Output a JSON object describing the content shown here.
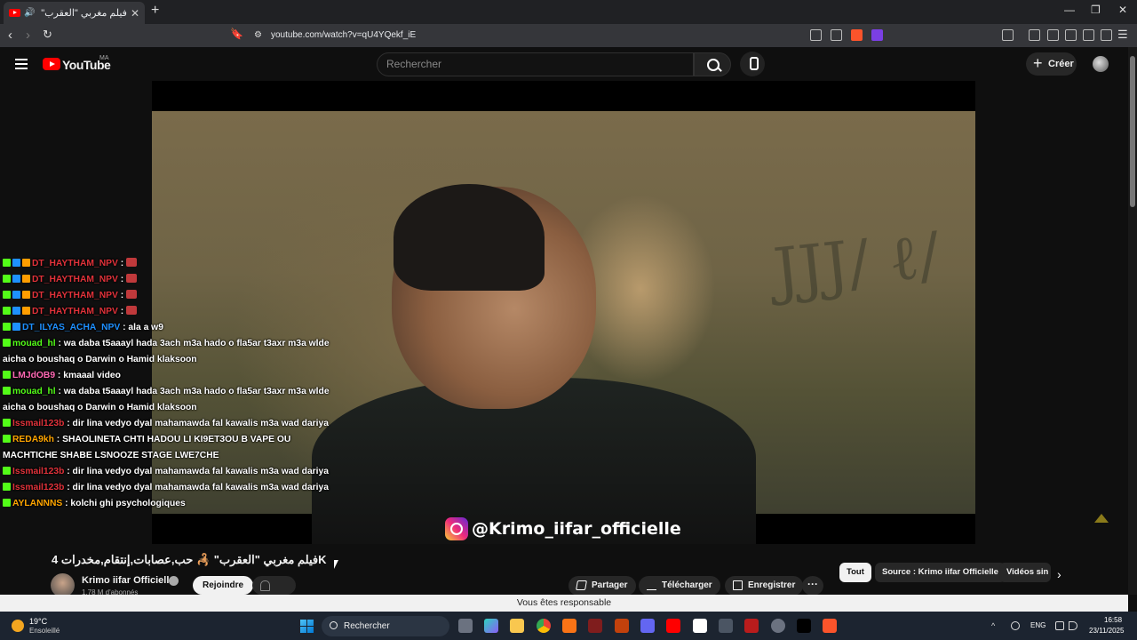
{
  "browser": {
    "tab_title": "فيلم مغربي \"العقرب\" 🦂 حب...",
    "new_tab": "+",
    "url": "youtube.com/watch?v=qU4YQekf_iE",
    "window_min": "—",
    "window_max": "❐",
    "window_close": "✕",
    "tab_close": "✕"
  },
  "youtube": {
    "logo_text": "YouTube",
    "country_code": "MA",
    "search_placeholder": "Rechercher",
    "create_label": "Créer"
  },
  "video": {
    "watermark": "@Krimo_iifar_officielle",
    "graffiti": "JJJ/ ℓ/"
  },
  "chat": [
    {
      "badges": [
        "k",
        "v",
        "o"
      ],
      "user": "DT_HAYTHAM_NPV",
      "user_color": "#e0323a",
      "text": "",
      "emote": true
    },
    {
      "badges": [
        "k",
        "v",
        "o"
      ],
      "user": "DT_HAYTHAM_NPV",
      "user_color": "#e0323a",
      "text": "",
      "emote": true
    },
    {
      "badges": [
        "k",
        "v",
        "o"
      ],
      "user": "DT_HAYTHAM_NPV",
      "user_color": "#e0323a",
      "text": "",
      "emote": true
    },
    {
      "badges": [
        "k",
        "v",
        "o"
      ],
      "user": "DT_HAYTHAM_NPV",
      "user_color": "#e0323a",
      "text": "",
      "emote": true
    },
    {
      "badges": [
        "k",
        "v"
      ],
      "user": "DT_ILYAS_ACHA_NPV",
      "user_color": "#1e90ff",
      "text": "ala a w9",
      "emote": false
    },
    {
      "badges": [
        "k"
      ],
      "user": "mouad_hl",
      "user_color": "#53fc18",
      "text": "wa daba t5aaayl hada 3ach m3a hado o fla5ar t3axr m3a wlde aicha o boushaq o Darwin o Hamid klaksoon",
      "emote": false
    },
    {
      "badges": [
        "k"
      ],
      "user": "LMJdOB9",
      "user_color": "#ff69b4",
      "text": "kmaaal video",
      "emote": false
    },
    {
      "badges": [
        "k"
      ],
      "user": "mouad_hl",
      "user_color": "#53fc18",
      "text": "wa daba t5aaayl hada 3ach m3a hado o fla5ar t3axr m3a wlde aicha o boushaq o Darwin o Hamid klaksoon",
      "emote": false
    },
    {
      "badges": [
        "k"
      ],
      "user": "Issmail123b",
      "user_color": "#e0323a",
      "text": "dir lina vedyo dyal mahamawda fal kawalis m3a wad dariya",
      "emote": false
    },
    {
      "badges": [
        "k"
      ],
      "user": "REDA9kh",
      "user_color": "#ffa500",
      "text": "SHAOLINETA CHTI HADOU LI KI9ET3OU B VAPE OU MACHTICHE SHABE LSNOOZE STAGE LWE7CHE",
      "emote": false
    },
    {
      "badges": [
        "k"
      ],
      "user": "Issmail123b",
      "user_color": "#e0323a",
      "text": "dir lina vedyo dyal mahamawda fal kawalis m3a wad dariya",
      "emote": false
    },
    {
      "badges": [
        "k"
      ],
      "user": "Issmail123b",
      "user_color": "#e0323a",
      "text": "dir lina vedyo dyal mahamawda fal kawalis m3a wad dariya",
      "emote": false
    },
    {
      "badges": [
        "k"
      ],
      "user": "AYLANNNS",
      "user_color": "#ffa500",
      "text": "kolchi ghi psychologiques",
      "emote": false
    }
  ],
  "meta": {
    "title": "فيلم مغربي \"العقرب\" 🦂 حب,عصابات,إنتقام,مخدرات 4K",
    "channel_name": "Krimo iifar Officielle",
    "subscribers": "1,78 M d'abonnés",
    "join_label": "Rejoindre",
    "share_label": "Partager",
    "download_label": "Télécharger",
    "save_label": "Enregistrer",
    "more_label": "···"
  },
  "chips": {
    "all": "Tout",
    "source": "Source : Krimo iifar Officielle",
    "similar": "Vidéos sin",
    "next": "›"
  },
  "notice": "Vous êtes responsable",
  "taskbar": {
    "temperature": "19°C",
    "condition": "Ensoleillé",
    "search_label": "Rechercher",
    "language": "ENG",
    "time": "16:58",
    "date": "23/11/2025"
  },
  "colors": {
    "youtube_red": "#ff0000",
    "kick_green": "#53fc18",
    "notice_bg": "#f1f1f1"
  }
}
